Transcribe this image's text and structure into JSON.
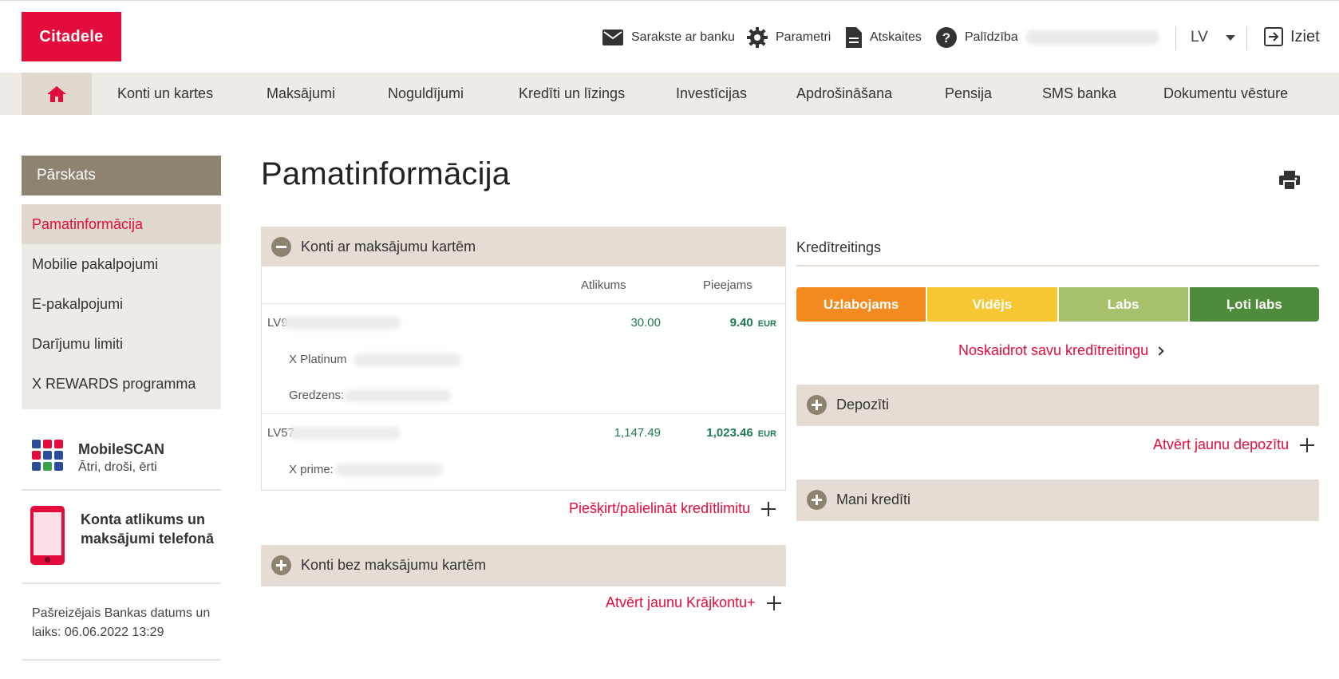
{
  "header": {
    "logo_text": "Citadele",
    "messages_label": "Sarakste ar banku",
    "settings_label": "Parametri",
    "reports_label": "Atskaites",
    "help_label": "Palīdzība",
    "language": "LV",
    "logout_label": "Iziet"
  },
  "nav": {
    "items": [
      "Konti un kartes",
      "Maksājumi",
      "Noguldījumi",
      "Kredīti un līzings",
      "Investīcijas",
      "Apdrošināšana",
      "Pensija",
      "SMS banka",
      "Dokumentu vēsture"
    ]
  },
  "sidebar": {
    "heading": "Pārskats",
    "items": [
      "Pamatinformācija",
      "Mobilie pakalpojumi",
      "E-pakalpojumi",
      "Darījumu limiti",
      "X REWARDS programma"
    ],
    "active_index": 0,
    "promo_mobilescan_title": "MobileSCAN",
    "promo_mobilescan_sub": "Ātri, droši, ērti",
    "promo_phone_text": "Konta atlikums un maksājumi telefonā",
    "bank_date_text": "Pašreizējais Bankas datums un laiks: 06.06.2022 13:29"
  },
  "main": {
    "title": "Pamatinformācija",
    "accounts_with_cards": {
      "label": "Konti ar maksājumu kartēm",
      "col_balance": "Atlikums",
      "col_available": "Pieejams",
      "rows": [
        {
          "iban_prefix": "LV9",
          "balance": "30.00",
          "available": "9.40",
          "currency": "EUR",
          "cards": [
            "X Platinum",
            "Gredzens:"
          ]
        },
        {
          "iban_prefix": "LV57",
          "balance": "1,147.49",
          "available": "1,023.46",
          "currency": "EUR",
          "cards": [
            "X prime:"
          ]
        }
      ],
      "link": "Piešķirt/palielināt kredītlimitu"
    },
    "accounts_without_cards": {
      "label": "Konti bez maksājumu kartēm",
      "link": "Atvērt jaunu Krājkontu+"
    },
    "credit_rating": {
      "title": "Kredītreitings",
      "levels": [
        {
          "label": "Uzlabojams",
          "color": "#f28a1f"
        },
        {
          "label": "Vidējs",
          "color": "#f6c633"
        },
        {
          "label": "Labs",
          "color": "#a6c06c"
        },
        {
          "label": "Ļoti labs",
          "color": "#4e8c3c"
        }
      ],
      "link": "Noskaidrot savu kredītreitingu"
    },
    "deposits": {
      "label": "Depozīti",
      "link": "Atvērt jaunu depozītu"
    },
    "loans": {
      "label": "Mani kredīti"
    }
  },
  "colors": {
    "brand_red": "#e30c3a",
    "nav_bg": "#eeebe6",
    "panel_bg": "#e5ddd3",
    "sidebar_head": "#8e8270",
    "amount_green": "#1e7a52"
  }
}
